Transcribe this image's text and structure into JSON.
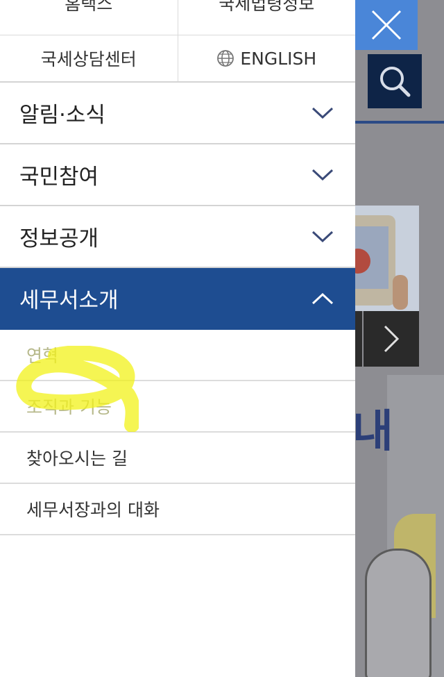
{
  "top_links": {
    "hometax": "홈택스",
    "law_info": "국세법령정보",
    "counsel_center": "국세상담센터",
    "english": "ENGLISH"
  },
  "menu": [
    {
      "label": "알림·소식",
      "state": "collapsed"
    },
    {
      "label": "국민참여",
      "state": "collapsed"
    },
    {
      "label": "정보공개",
      "state": "collapsed"
    },
    {
      "label": "세무서소개",
      "state": "expanded"
    }
  ],
  "submenu": [
    {
      "label": "연혁"
    },
    {
      "label": "조직과 기능"
    },
    {
      "label": "찾아오시는 길"
    },
    {
      "label": "세무서장과의 대화"
    }
  ],
  "background": {
    "banner_text": "내"
  },
  "colors": {
    "active_menu_bg": "#1e4d91",
    "close_button_bg": "#4a86d8",
    "highlight_marker": "#f2f21a"
  },
  "icons": {
    "close": "close-x-icon",
    "search": "search-icon",
    "globe": "globe-icon",
    "chevron_down": "chevron-down-icon",
    "chevron_up": "chevron-up-icon",
    "next": "chevron-right-icon"
  }
}
